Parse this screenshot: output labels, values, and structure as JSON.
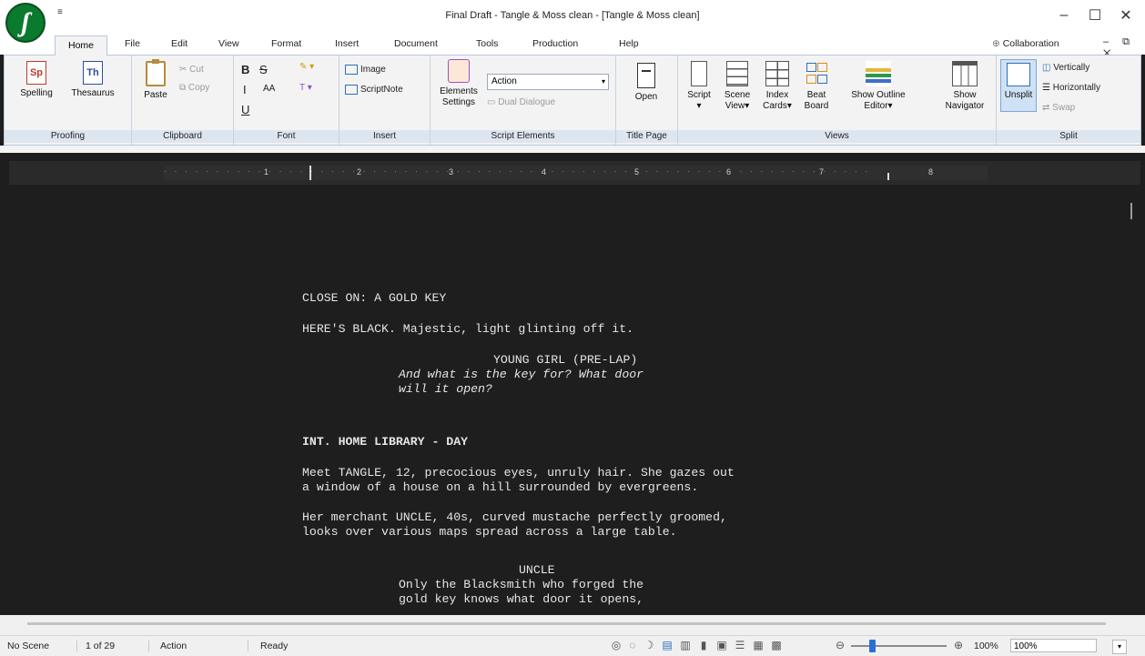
{
  "window": {
    "title": "Final Draft - Tangle & Moss clean - [Tangle & Moss clean]",
    "qa_icon": "≡",
    "min_icon": "–",
    "max_icon": "☐",
    "close_icon": "✕"
  },
  "menu": {
    "tabs": [
      "Home",
      "File",
      "Edit",
      "View",
      "Format",
      "Insert",
      "Document",
      "Tools",
      "Production",
      "Help"
    ],
    "collaboration": "Collaboration",
    "mdi_controls": "– ⧉ ✕"
  },
  "ribbon": {
    "proofing": {
      "label": "Proofing",
      "spelling": "Spelling",
      "thesaurus": "Thesaurus",
      "sp_icon": "Sp",
      "th_icon": "Th"
    },
    "clipboard": {
      "label": "Clipboard",
      "paste": "Paste",
      "cut": "Cut",
      "copy": "Copy"
    },
    "font": {
      "label": "Font",
      "bold": "B",
      "strike": "S",
      "italic": "I",
      "underline": "U",
      "size": "AA",
      "highlight": "✎",
      "color": "T"
    },
    "insert": {
      "label": "Insert",
      "image": "Image",
      "scriptnote": "ScriptNote"
    },
    "script_elements": {
      "label": "Script Elements",
      "elements_settings_1": "Elements",
      "elements_settings_2": "Settings",
      "element_select": "Action",
      "dual_dialogue": "Dual Dialogue"
    },
    "title_page": {
      "label": "Title Page",
      "open": "Open"
    },
    "views": {
      "label": "Views",
      "script": "Script",
      "script_sub": "▾",
      "scene_view_1": "Scene",
      "scene_view_2": "View▾",
      "index_cards_1": "Index",
      "index_cards_2": "Cards▾",
      "beat_board_1": "Beat",
      "beat_board_2": "Board",
      "outline_1": "Show Outline",
      "outline_2": "Editor▾",
      "navigator_1": "Show",
      "navigator_2": "Navigator"
    },
    "split": {
      "label": "Split",
      "unsplit": "Unsplit",
      "vertically": "Vertically",
      "horizontally": "Horizontally",
      "swap": "Swap"
    }
  },
  "ruler": {
    "numbers": [
      "1",
      "2",
      "3",
      "4",
      "5",
      "6",
      "7",
      "8"
    ]
  },
  "script": {
    "lines": [
      {
        "text": "CLOSE ON: A GOLD KEY",
        "style": ""
      },
      {
        "text": "HERE'S BLACK. Majestic, light glinting off it.",
        "style": ""
      },
      {
        "text": "YOUNG GIRL (PRE-LAP)",
        "style": ""
      },
      {
        "text": "And what is the key for? What door",
        "style": "italic"
      },
      {
        "text": "will it open?",
        "style": "italic"
      },
      {
        "text": "INT. HOME LIBRARY - DAY",
        "style": "bold"
      },
      {
        "text": "Meet TANGLE, 12, precocious eyes, unruly hair. She gazes out",
        "style": ""
      },
      {
        "text": "a window of a house on a hill surrounded by evergreens.",
        "style": ""
      },
      {
        "text": "Her merchant UNCLE, 40s, curved mustache perfectly groomed,",
        "style": ""
      },
      {
        "text": "looks over various maps spread across a large table.",
        "style": ""
      },
      {
        "text": "UNCLE",
        "style": ""
      },
      {
        "text": "Only the Blacksmith who forged the",
        "style": ""
      },
      {
        "text": "gold key knows what door it opens,",
        "style": ""
      }
    ]
  },
  "status": {
    "scene": "No Scene",
    "page": "1 of 29",
    "element": "Action",
    "state": "Ready",
    "zoom_percent": "100%",
    "zoom_field": "100%",
    "zoom_level": 0.2,
    "zoom_out": "⊖",
    "zoom_in": "⊕",
    "dropdown": "▾"
  }
}
